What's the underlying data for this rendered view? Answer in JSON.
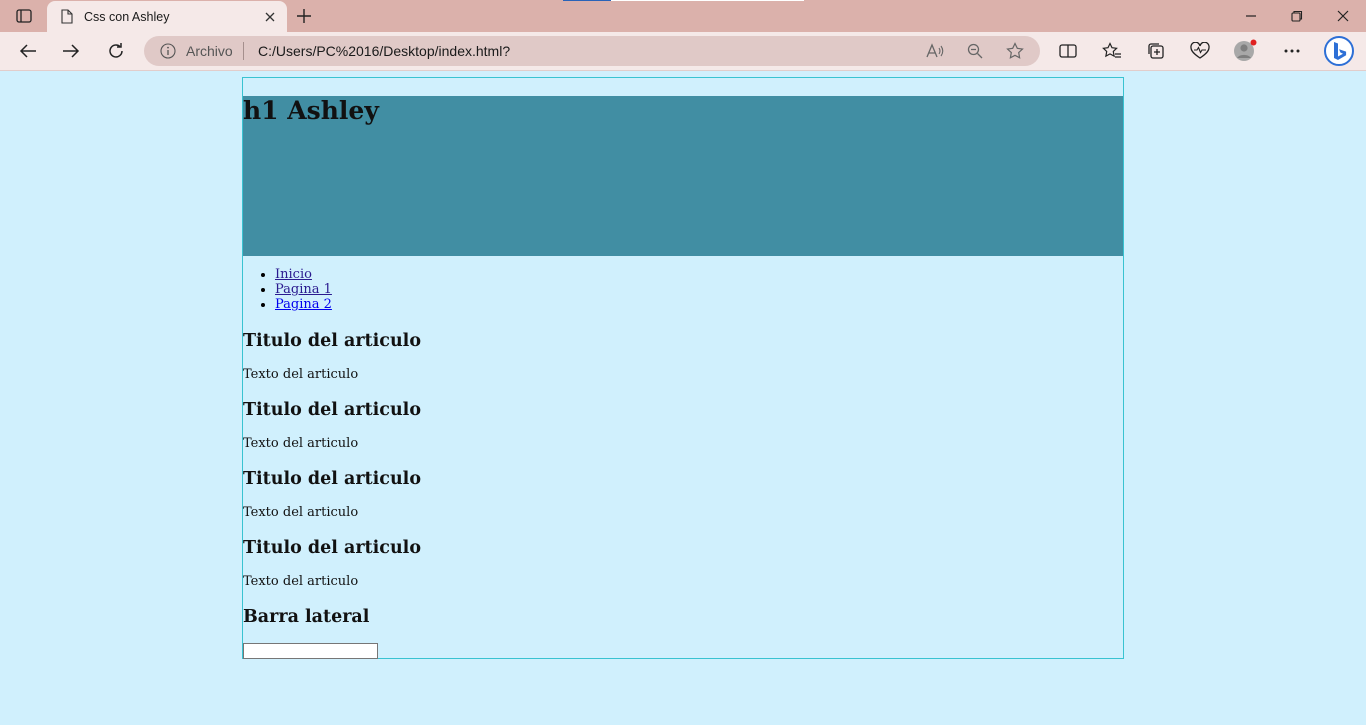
{
  "browser": {
    "tab_title": "Css con Ashley",
    "address_label": "Archivo",
    "url": "C:/Users/PC%2016/Desktop/index.html?"
  },
  "page": {
    "header_title": "h1 Ashley",
    "nav_items": [
      {
        "label": "Inicio"
      },
      {
        "label": "Pagina 1"
      },
      {
        "label": "Pagina 2"
      }
    ],
    "articles": [
      {
        "title": "Titulo del articulo",
        "text": "Texto del articulo"
      },
      {
        "title": "Titulo del articulo",
        "text": "Texto del articulo"
      },
      {
        "title": "Titulo del articulo",
        "text": "Texto del articulo"
      },
      {
        "title": "Titulo del articulo",
        "text": "Texto del articulo"
      }
    ],
    "sidebar_title": "Barra lateral",
    "sidebar_input_value": ""
  },
  "colors": {
    "page_background": "#d0f0fd",
    "header_background": "#418ea3",
    "container_border": "#39c3d1",
    "tabbar": "#dbb1ab",
    "toolbar": "#f5e9e8"
  }
}
